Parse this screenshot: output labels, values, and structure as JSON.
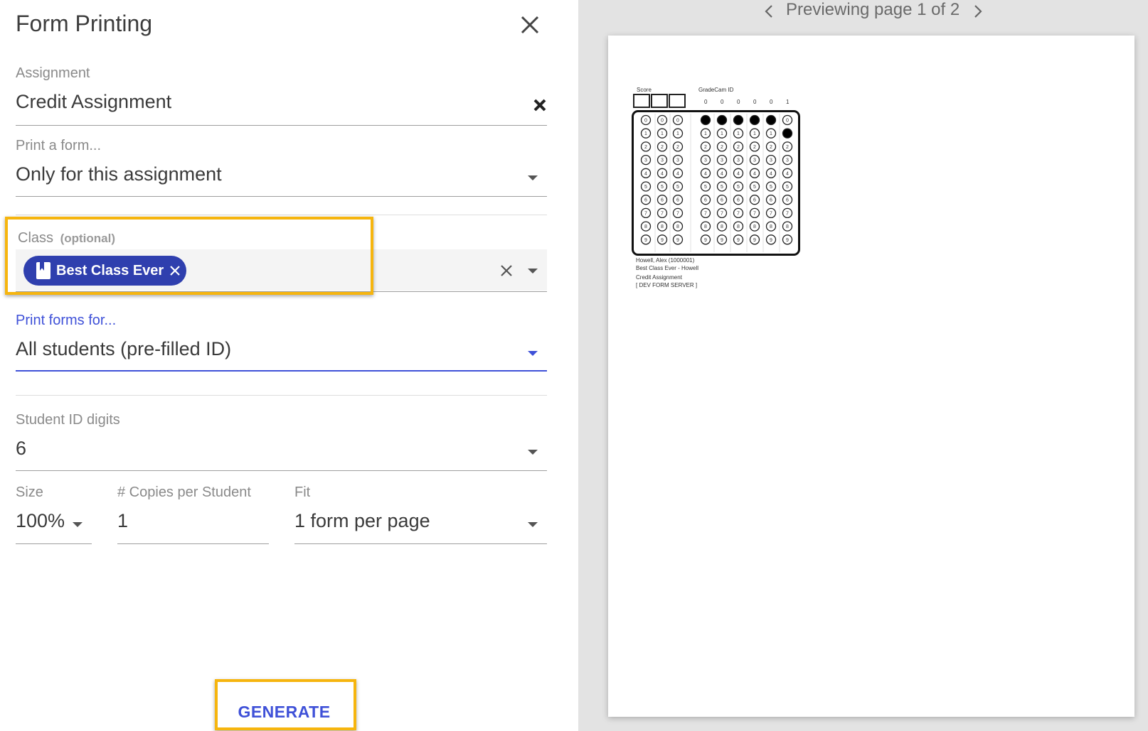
{
  "dialog": {
    "title": "Form Printing",
    "assignment": {
      "label": "Assignment",
      "value": "Credit Assignment"
    },
    "print_a_form": {
      "label": "Print a form...",
      "value": "Only for this assignment"
    },
    "class": {
      "label": "Class",
      "optional": "(optional)",
      "chip": "Best Class Ever"
    },
    "print_forms_for": {
      "label": "Print forms for...",
      "value": "All students (pre-filled ID)"
    },
    "student_id_digits": {
      "label": "Student ID digits",
      "value": "6"
    },
    "size": {
      "label": "Size",
      "value": "100%"
    },
    "copies": {
      "label": "# Copies per Student",
      "value": "1"
    },
    "fit": {
      "label": "Fit",
      "value": "1 form per page"
    },
    "generate_label": "GENERATE"
  },
  "preview": {
    "pager_text": "Previewing page 1 of 2",
    "form": {
      "score_label": "Score",
      "id_label": "GradeCam ID",
      "id_digits": [
        "0",
        "0",
        "0",
        "0",
        "0",
        "1"
      ],
      "info_lines": [
        "Howell, Alex (1000001)",
        "Best Class Ever - Howell",
        "Credit Assignment",
        "[ DEV FORM SERVER ]"
      ]
    }
  },
  "colors": {
    "accent": "#3f51d8",
    "chip": "#2f3fae",
    "highlight": "#f6b50e"
  },
  "icons": [
    "close-icon",
    "clear-icon",
    "dropdown-caret-icon",
    "book-icon",
    "chevron-left-icon",
    "chevron-right-icon"
  ]
}
